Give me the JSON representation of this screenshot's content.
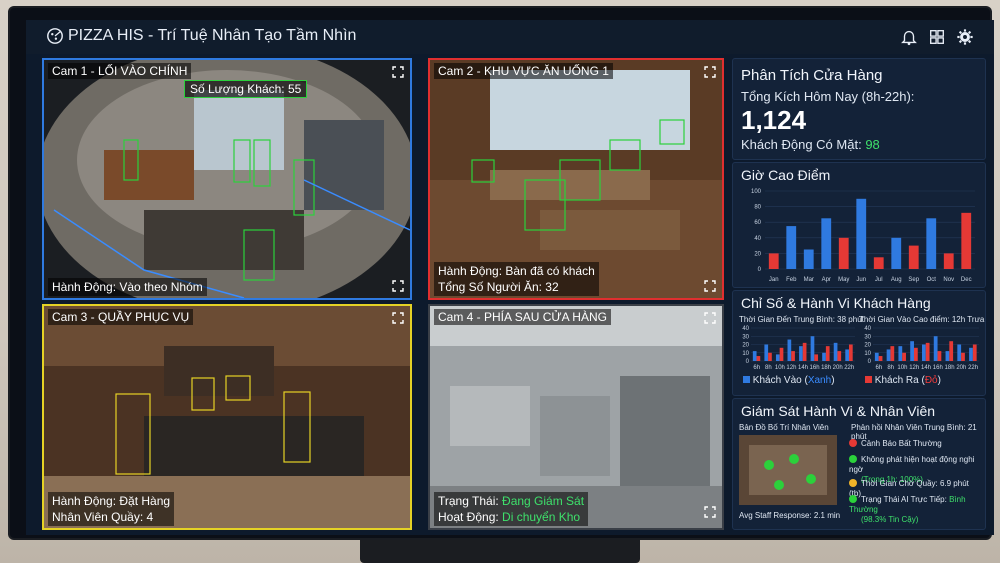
{
  "app": {
    "title": "PIZZA HIS - Trí Tuệ Nhân Tạo Tầm Nhìn"
  },
  "icons": {
    "logo": "pizza-logo-icon",
    "bell": "bell-icon",
    "grid": "grid-icon",
    "gear": "gear-icon",
    "expand": "expand-icon"
  },
  "cams": [
    {
      "label": "Cam 1 - LỐI VÀO CHÍNH",
      "tag": "Số Lượng Khách: 55",
      "line1": "Hành Động: Vào theo Nhóm",
      "line2": "",
      "border": "#2f7ae0"
    },
    {
      "label": "Cam 2 - KHU VỰC ĂN UỐNG 1",
      "line1": "Hành Động: Bàn đã có khách",
      "line2": "Tổng Số Người Ăn: 32",
      "border": "#e02f2f"
    },
    {
      "label": "Cam 3 - QUẦY PHỤC VỤ",
      "line1": "Hành Động: Đặt Hàng",
      "line2": "Nhân Viên Quầy: 4",
      "border": "#e5d225"
    },
    {
      "label": "Cam 4 - PHÍA SAU CỬA HÀNG",
      "line1_prefix": "Trạng Thái: ",
      "line1_value": "Đang Giám Sát",
      "line2_prefix": "Hoạt Động: ",
      "line2_value": "Di chuyển Kho",
      "border": "#3a3f47"
    }
  ],
  "store": {
    "title": "Phân Tích Cửa Hàng",
    "today_label": "Tổng Kích Hôm Nay (8h-22h):",
    "today_value": "1,124",
    "present_label": "Khách Động Có Mặt:",
    "present_value": "98"
  },
  "peak": {
    "title": "Giờ Cao Điểm"
  },
  "behavior": {
    "title": "Chỉ Số & Hành Vi Khách Hàng",
    "left_caption": "Thời Gian Đến Trung Bình: 38 phút",
    "right_caption": "Thời Gian Vào Cao điểm: 12h Trưa",
    "legend_in_prefix": "Khách Vào (",
    "legend_in_word": "Xanh",
    "legend_in_suffix": ")",
    "legend_out_prefix": "Khách Ra (",
    "legend_out_word": "Đỏ",
    "legend_out_suffix": ")"
  },
  "staff": {
    "title": "Giám Sát Hành Vi & Nhân Viên",
    "map_label": "Bản Đồ Bố Trí Nhân Viên",
    "response_label": "Phản hồi Nhân Viên Trung Bình: 21 phút",
    "avg_response": "Avg Staff Response: 2.1 min",
    "alerts": [
      {
        "text": "Cảnh Báo Bất Thường",
        "sub": "",
        "color": "#e53935",
        "icon": "warning-icon"
      },
      {
        "text": "Không phát hiện hoạt động nghi ngờ",
        "sub": "(Trong 1h: 100%)",
        "color": "#2bd13b",
        "icon": "check-icon"
      },
      {
        "text": "Thời Gian Chờ Quầy: 6.9 phút (tb)",
        "sub": "",
        "color": "#f0b429",
        "icon": "clock-icon"
      },
      {
        "text": "Trạng Thái AI Trực Tiếp: ",
        "value": "Bình Thường",
        "sub": "(98.3% Tin Cậy)",
        "color": "#2bd13b",
        "icon": "gear-status-icon"
      }
    ]
  },
  "colors": {
    "blue": "#2f7ae0",
    "red": "#e53935",
    "green": "#3ee06b"
  },
  "chart_data": [
    {
      "type": "bar",
      "title": "Giờ Cao Điểm",
      "categories": [
        "Jan",
        "Feb",
        "Mar",
        "Apr",
        "May",
        "Jun",
        "Jul",
        "Aug",
        "Sep",
        "Oct",
        "Nov",
        "Dec"
      ],
      "values": [
        20,
        55,
        25,
        65,
        40,
        90,
        15,
        40,
        30,
        65,
        20,
        72
      ],
      "colors": [
        "red",
        "blue",
        "blue",
        "blue",
        "red",
        "blue",
        "red",
        "blue",
        "red",
        "blue",
        "red",
        "red"
      ],
      "ylim": [
        0,
        100
      ],
      "yticks": [
        0,
        20,
        40,
        60,
        80,
        100
      ]
    },
    {
      "type": "bar",
      "categories": [
        "6h",
        "8h",
        "10h",
        "12h",
        "14h",
        "16h",
        "18h",
        "20h",
        "22h"
      ],
      "series": [
        {
          "name": "Khách Vào",
          "values": [
            12,
            20,
            8,
            26,
            18,
            30,
            10,
            22,
            14
          ]
        },
        {
          "name": "Khách Ra",
          "values": [
            6,
            10,
            16,
            12,
            22,
            8,
            18,
            12,
            20
          ]
        }
      ],
      "ylim": [
        0,
        40
      ],
      "yticks": [
        0,
        10,
        20,
        30,
        40
      ]
    },
    {
      "type": "bar",
      "categories": [
        "6h",
        "8h",
        "10h",
        "12h",
        "14h",
        "16h",
        "18h",
        "20h",
        "22h"
      ],
      "series": [
        {
          "name": "Khách Vào",
          "values": [
            10,
            14,
            18,
            24,
            20,
            30,
            12,
            20,
            16
          ]
        },
        {
          "name": "Khách Ra",
          "values": [
            6,
            18,
            10,
            16,
            22,
            12,
            24,
            10,
            20
          ]
        }
      ],
      "ylim": [
        0,
        40
      ],
      "yticks": [
        0,
        10,
        20,
        30,
        40
      ]
    }
  ]
}
